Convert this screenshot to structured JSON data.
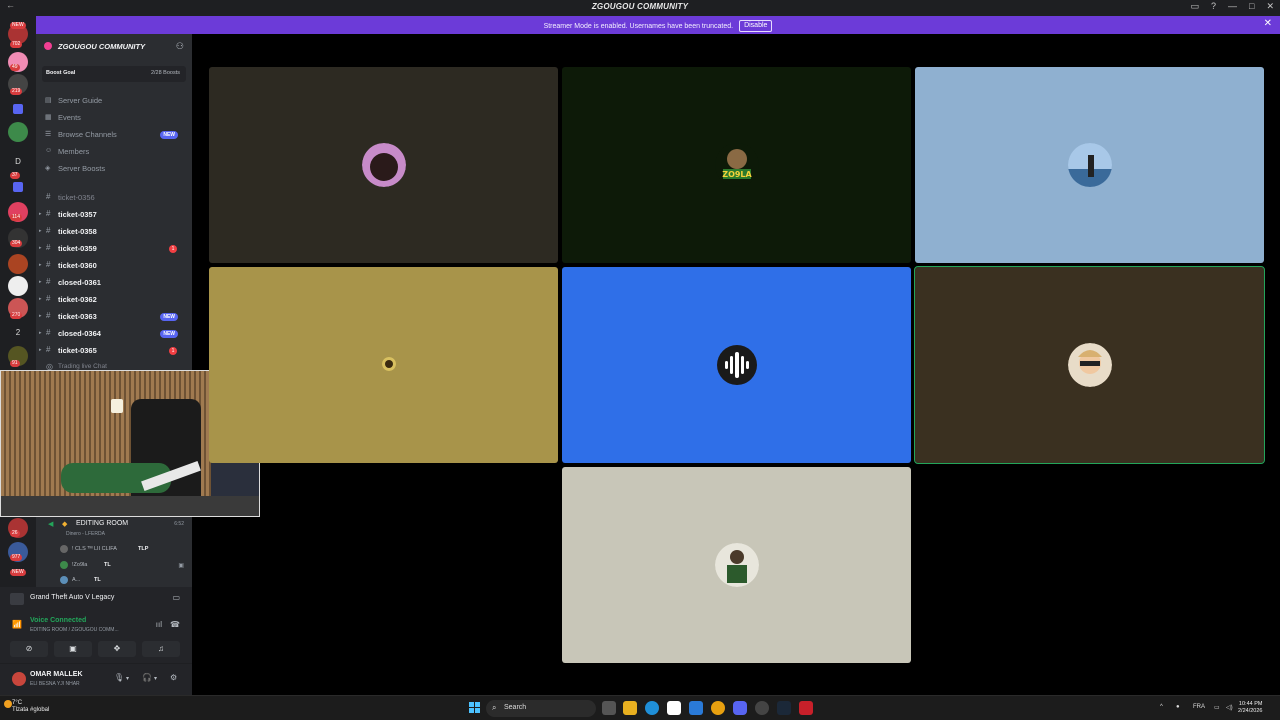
{
  "window": {
    "title": "ZGOUGOU COMMUNITY"
  },
  "banner": {
    "text": "Streamer Mode is enabled. Usernames have been truncated.",
    "disable_label": "Disable"
  },
  "guilds": {
    "badges": [
      "NEW",
      "702",
      "49",
      "219",
      "37",
      "114",
      "304",
      "91",
      "270",
      "91",
      "26",
      "977",
      "NEW"
    ],
    "letters": [
      "D",
      "2"
    ]
  },
  "server": {
    "name": "ZGOUGOU COMMUNITY",
    "boost_goal_label": "Boost Goal",
    "boost_count": "2/28 Boosts",
    "nav": [
      {
        "label": "Server Guide",
        "icon": "map-icon"
      },
      {
        "label": "Events",
        "icon": "calendar-icon"
      },
      {
        "label": "Browse Channels",
        "icon": "list-icon",
        "badge": "NEW"
      },
      {
        "label": "Members",
        "icon": "members-icon"
      },
      {
        "label": "Server Boosts",
        "icon": "boost-icon"
      }
    ],
    "channels": [
      {
        "name": "ticket-0356",
        "muted": true
      },
      {
        "name": "ticket-0357"
      },
      {
        "name": "ticket-0358"
      },
      {
        "name": "ticket-0359",
        "count": "1"
      },
      {
        "name": "ticket-0360"
      },
      {
        "name": "closed-0361"
      },
      {
        "name": "ticket-0362"
      },
      {
        "name": "ticket-0363",
        "badge": "NEW"
      },
      {
        "name": "closed-0364",
        "badge": "NEW"
      },
      {
        "name": "ticket-0365",
        "count": "1"
      }
    ],
    "partial_channel": "Trading live Chat"
  },
  "voice_room": {
    "name": "EDITING ROOM",
    "time": "6:52",
    "sub": "Dinero - LFERDA",
    "users": [
      "! CLS ᵀᴹ LII CLIFA",
      "!Zo9la",
      "A..."
    ],
    "user_tags": [
      "TLP",
      "TL",
      "TL"
    ]
  },
  "activity": {
    "game": "Grand Theft Auto V Legacy"
  },
  "voice_status": {
    "status": "Voice Connected",
    "sub": "EDITING ROOM / ZGOUGOU COMM..."
  },
  "user": {
    "name": "OMAR MALLEK",
    "status": "ELI BESNA YJI NHAR"
  },
  "tiles": [
    {
      "bg": "#2d2a22",
      "avatar_color": "#c78bc9",
      "speaking": false
    },
    {
      "bg": "#0d1a08",
      "avatar_color": "#3f7a2c",
      "speaking": false,
      "avatar_text": "ZO9LA"
    },
    {
      "bg": "#8fb0d0",
      "avatar_color": "#5c8fb8",
      "speaking": false
    },
    {
      "bg": "#a8944a",
      "avatar_color": "#6b5a20",
      "speaking": false
    },
    {
      "bg": "#2f6fe8",
      "avatar_color": "#1a1a1a",
      "speaking": false,
      "icon": "audio-wave-icon"
    },
    {
      "bg": "#3a3020",
      "avatar_color": "#c9a67a",
      "speaking": true
    },
    {
      "bg": "#c8c6b8",
      "avatar_color": "#4a6a3a",
      "speaking": false
    }
  ],
  "taskbar": {
    "weather_temp": "7°C",
    "weather_desc": "Tlzata #global",
    "search_label": "Search",
    "lang": "FRA",
    "time": "10:44 PM",
    "date": "2/24/2026"
  }
}
